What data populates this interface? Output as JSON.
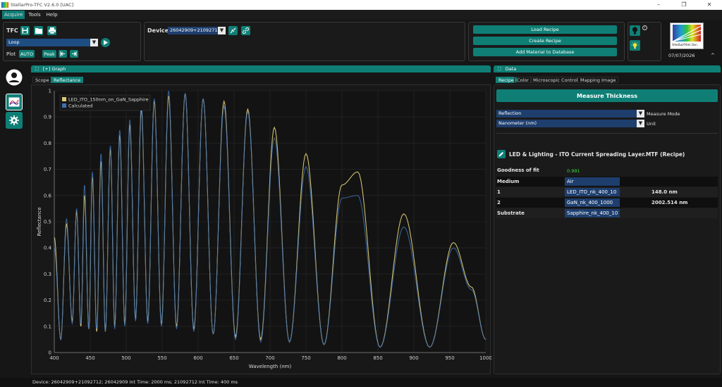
{
  "window": {
    "title": "StellarPro-TFC V2.6.0 [UAC]"
  },
  "menu": {
    "items": [
      "Acquire",
      "Tools",
      "Help"
    ]
  },
  "tfc": {
    "label": "TFC",
    "mode": "Loop",
    "plot_label": "Plot",
    "auto_label": "AUTO",
    "peak_label": "Peak"
  },
  "device": {
    "label": "Device",
    "value": "26042909+21092712"
  },
  "recipe_buttons": {
    "load": "Load Recipe",
    "create": "Create Recipe",
    "add_material": "Add Material to Database"
  },
  "logo": {
    "text": "StellarNet Inc.",
    "date": "07/07/2026"
  },
  "graph": {
    "header": "[+]  Graph",
    "tabs": [
      "Scope",
      "Reflectance"
    ],
    "active_tab": "Reflectance"
  },
  "data_panel": {
    "header": "Data",
    "tabs": [
      "Recipe",
      "Color",
      "Microscopic Control",
      "Mapping Image"
    ],
    "measure_button": "Measure Thickness",
    "measure_mode_value": "Reflection",
    "measure_mode_label": "Measure Mode",
    "unit_value": "Nanometer (nm)",
    "unit_label": "Unit",
    "recipe_name": "LED & Lighting - ITO Current Spreading Layer.MTF (Recipe)",
    "gof_label": "Goodness of fit",
    "gof_value": "0.991",
    "rows": [
      {
        "name": "Medium",
        "material": "Air",
        "thickness": ""
      },
      {
        "name": "1",
        "material": "LED_ITO_nk_400_10",
        "thickness": "148.0 nm"
      },
      {
        "name": "2",
        "material": "GaN_nk_400_1000",
        "thickness": "2002.514 nm"
      },
      {
        "name": "Substrate",
        "material": "Sapphire_nk_400_10",
        "thickness": ""
      }
    ]
  },
  "status": {
    "text": "Device: 26042909+21092712;  26042909 Int Time: 2000 ms;  21092712 Int Time: 400 ms"
  },
  "colors": {
    "accent": "#0f7f76",
    "measured": "#d8c873",
    "calculated": "#3f6fb0"
  },
  "chart_data": {
    "type": "line",
    "xlabel": "Wavelength (nm)",
    "ylabel": "Reflectance",
    "xlim": [
      400,
      1000
    ],
    "ylim": [
      0,
      1
    ],
    "x_ticks": [
      400,
      450,
      500,
      550,
      600,
      650,
      700,
      750,
      800,
      850,
      900,
      950,
      1000
    ],
    "y_ticks": [
      0,
      0.1,
      0.2,
      0.3,
      0.4,
      0.5,
      0.6,
      0.7,
      0.8,
      0.9,
      1
    ],
    "y_tick_labels": [
      "0",
      "0.1",
      "0.2",
      "0.3",
      "0.4",
      "0.5",
      "0.6",
      "0.7",
      "0.8",
      "0.9",
      "1"
    ],
    "legend_position": "top-left",
    "grid": true,
    "series": [
      {
        "name": "LED_ITO_150nm_on_GaN_Sapphire",
        "color": "#d8c873",
        "x": [
          400,
          409,
          417,
          425,
          431,
          437,
          442,
          448,
          453,
          459,
          465,
          471,
          478,
          484,
          491,
          498,
          505,
          513,
          521,
          530,
          539,
          549,
          559,
          570,
          582,
          594,
          607,
          621,
          636,
          652,
          669,
          687,
          706,
          727,
          750,
          775,
          800,
          822,
          853,
          886,
          922,
          955,
          980,
          1000
        ],
        "y": [
          0.44,
          0.05,
          0.49,
          0.12,
          0.54,
          0.1,
          0.6,
          0.09,
          0.67,
          0.08,
          0.73,
          0.08,
          0.78,
          0.1,
          0.83,
          0.11,
          0.87,
          0.13,
          0.93,
          0.12,
          0.96,
          0.11,
          0.98,
          0.1,
          0.99,
          0.09,
          0.97,
          0.07,
          0.96,
          0.06,
          0.93,
          0.05,
          0.86,
          0.04,
          0.76,
          0.03,
          0.64,
          0.69,
          0.02,
          0.53,
          0.02,
          0.42,
          0.25,
          0.05
        ]
      },
      {
        "name": "Calculated",
        "color": "#3f6fb0",
        "x": [
          400,
          409,
          417,
          425,
          431,
          437,
          442,
          448,
          453,
          459,
          465,
          471,
          478,
          484,
          491,
          498,
          505,
          513,
          521,
          530,
          539,
          549,
          559,
          570,
          582,
          594,
          607,
          621,
          636,
          652,
          669,
          687,
          706,
          727,
          750,
          775,
          800,
          822,
          853,
          886,
          922,
          955,
          980,
          1000
        ],
        "y": [
          0.4,
          0.05,
          0.51,
          0.11,
          0.55,
          0.11,
          0.64,
          0.09,
          0.69,
          0.09,
          0.76,
          0.08,
          0.79,
          0.09,
          0.85,
          0.1,
          0.89,
          0.12,
          0.95,
          0.11,
          0.97,
          0.1,
          1.0,
          0.09,
          0.99,
          0.08,
          0.97,
          0.07,
          0.94,
          0.05,
          0.92,
          0.04,
          0.82,
          0.04,
          0.71,
          0.03,
          0.59,
          0.6,
          0.02,
          0.48,
          0.02,
          0.4,
          0.24,
          0.05
        ]
      }
    ]
  }
}
